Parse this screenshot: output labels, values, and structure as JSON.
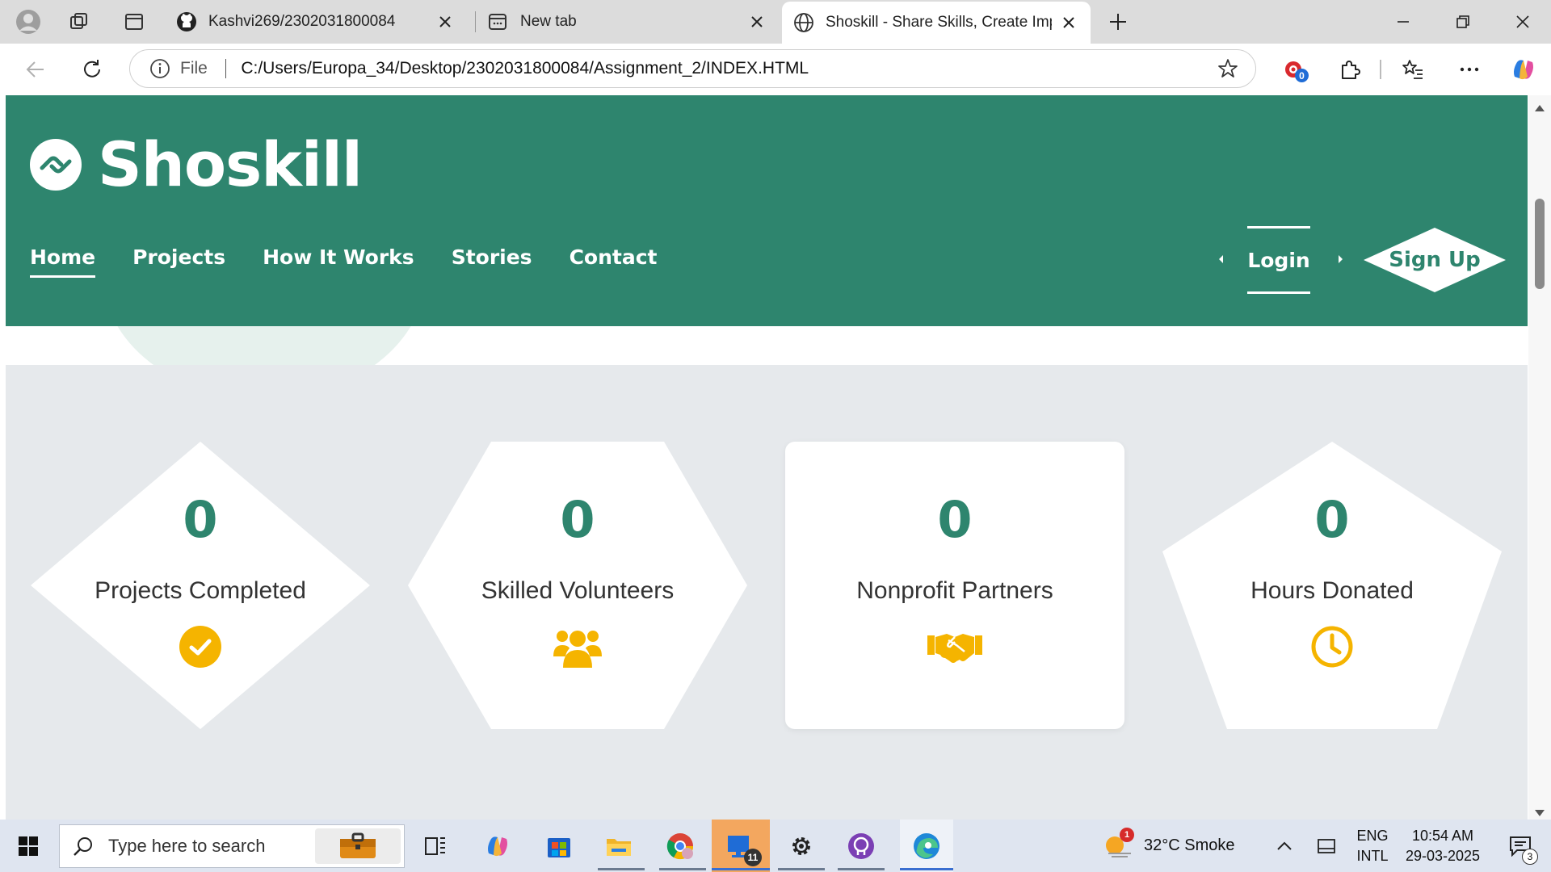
{
  "browser": {
    "tabs": [
      {
        "title": "Kashvi269/2302031800084",
        "icon": "github-icon"
      },
      {
        "title": "New tab",
        "icon": "newtab-icon"
      },
      {
        "title": "Shoskill - Share Skills, Create Impa",
        "icon": "globe-icon",
        "active": true
      }
    ],
    "address": {
      "scheme_label": "File",
      "url": "C:/Users/Europa_34/Desktop/2302031800084/Assignment_2/INDEX.HTML"
    },
    "extension_badge": "0"
  },
  "site": {
    "brand": "Shoskill",
    "nav": [
      {
        "label": "Home",
        "active": true
      },
      {
        "label": "Projects"
      },
      {
        "label": "How It Works"
      },
      {
        "label": "Stories"
      },
      {
        "label": "Contact"
      }
    ],
    "login_label": "Login",
    "signup_label": "Sign Up",
    "accent_color": "#2e856e",
    "icon_color": "#f5b400",
    "stats": [
      {
        "value": "0",
        "label": "Projects Completed",
        "icon": "check-circle-icon",
        "shape": "diamond"
      },
      {
        "value": "0",
        "label": "Skilled Volunteers",
        "icon": "users-icon",
        "shape": "hexagon"
      },
      {
        "value": "0",
        "label": "Nonprofit Partners",
        "icon": "handshake-icon",
        "shape": "rounded-rectangle"
      },
      {
        "value": "0",
        "label": "Hours Donated",
        "icon": "clock-icon",
        "shape": "pentagon"
      }
    ]
  },
  "taskbar": {
    "search_placeholder": "Type here to search",
    "weather": "32°C  Smoke",
    "weather_badge": "1",
    "lang_top": "ENG",
    "lang_bottom": "INTL",
    "time": "10:54 AM",
    "date": "29-03-2025",
    "notif_count": "3",
    "app_badge": "11"
  }
}
